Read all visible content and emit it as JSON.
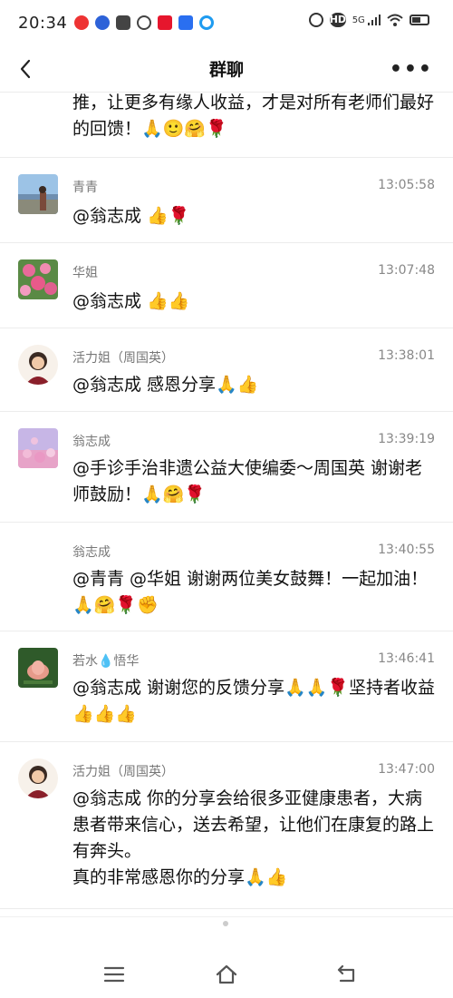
{
  "status_bar": {
    "time": "20:34",
    "left_icons": [
      "app-icon-netease",
      "baidu-paw-icon",
      "shield-icon",
      "alarm-icon",
      "weibo-icon",
      "translate-icon",
      "browser-icon"
    ],
    "right_icons": [
      "alarm-icon",
      "hd-icon",
      "5g-signal-icon",
      "wifi-icon",
      "battery-icon"
    ],
    "hd_label": "HD",
    "network_label": "5G"
  },
  "nav": {
    "title": "群聊",
    "back_icon": "back-arrow-icon",
    "more_label": "•••"
  },
  "messages": [
    {
      "sender": "",
      "time": "",
      "text": "推，让更多有缘人收益，才是对所有老师们最好的回馈！🙏🙂🤗🌹",
      "avatar": ""
    },
    {
      "sender": "青青",
      "time": "13:05:58",
      "text": "@翁志成 👍🌹",
      "avatar": "avatar-lake-photo"
    },
    {
      "sender": "华姐",
      "time": "13:07:48",
      "text": "@翁志成 👍👍",
      "avatar": "avatar-pink-flowers"
    },
    {
      "sender": "活力姐（周国英）",
      "time": "13:38:01",
      "text": "@翁志成 感恩分享🙏👍",
      "avatar": "avatar-woman-portrait"
    },
    {
      "sender": "翁志成",
      "time": "13:39:19",
      "text": "@手诊手治非遗公益大使编委～周国英 谢谢老师鼓励！🙏🤗🌹",
      "avatar": "avatar-pink-blossom"
    },
    {
      "sender": "翁志成",
      "time": "13:40:55",
      "text": "@青青 @华姐 谢谢两位美女鼓舞！一起加油！🙏🤗🌹✊",
      "avatar": ""
    },
    {
      "sender": "若水💧悟华",
      "time": "13:46:41",
      "text": "@翁志成 谢谢您的反馈分享🙏🙏🌹坚持者收益👍👍👍",
      "avatar": "avatar-lotus"
    },
    {
      "sender": "活力姐（周国英）",
      "time": "13:47:00",
      "text": "@翁志成 你的分享会给很多亚健康患者，大病患者带来信心，送去希望，让他们在康复的路上有奔头。\n真的非常感恩你的分享🙏👍",
      "avatar": "avatar-woman-portrait"
    }
  ],
  "bottom_nav": {
    "items": [
      "menu-icon",
      "home-icon",
      "back-icon"
    ]
  },
  "colors": {
    "background": "#ffffff",
    "divider": "#ececec",
    "meta_text": "#888888",
    "message_text": "#111111"
  }
}
